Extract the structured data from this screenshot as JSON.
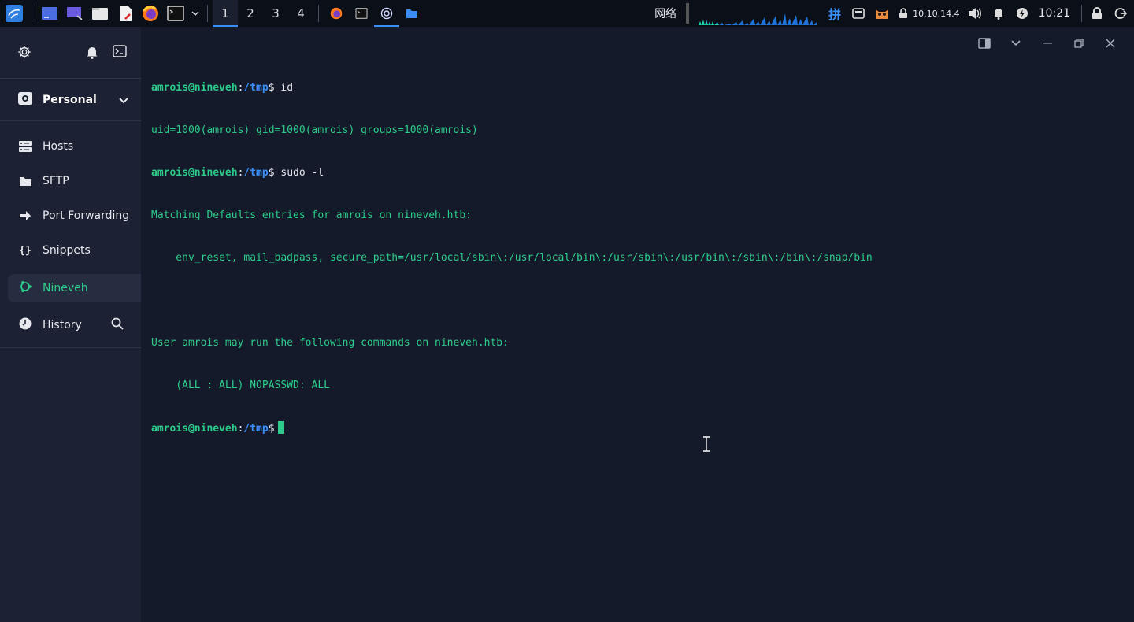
{
  "taskbar": {
    "workspaces": [
      "1",
      "2",
      "3",
      "4"
    ],
    "tray": {
      "network_label": "网络",
      "input_method": "拼",
      "vpn_ip": "10.10.14.4",
      "clock": "10:21"
    }
  },
  "sidebar": {
    "vault_label": "Personal",
    "items": [
      {
        "label": "Hosts",
        "icon": "hosts-icon"
      },
      {
        "label": "SFTP",
        "icon": "folder-icon"
      },
      {
        "label": "Port Forwarding",
        "icon": "forward-icon"
      },
      {
        "label": "Snippets",
        "icon": "braces-icon"
      }
    ],
    "active_session": "Nineveh",
    "history_label": "History"
  },
  "terminal": {
    "prompt_user": "amrois@nineveh",
    "prompt_path": "/tmp",
    "cmd1": "id",
    "out1": "uid=1000(amrois) gid=1000(amrois) groups=1000(amrois)",
    "cmd2": "sudo -l",
    "out2a": "Matching Defaults entries for amrois on nineveh.htb:",
    "out2b": "    env_reset, mail_badpass, secure_path=/usr/local/sbin\\:/usr/local/bin\\:/usr/sbin\\:/usr/bin\\:/sbin\\:/bin\\:/snap/bin",
    "out2c": "User amrois may run the following commands on nineveh.htb:",
    "out2d": "    (ALL : ALL) NOPASSWD: ALL"
  },
  "colors": {
    "accent_green": "#2ecc8a",
    "accent_blue": "#3a8ef6",
    "terminal_bg": "#141a2a",
    "sidebar_bg": "#1c2233"
  }
}
